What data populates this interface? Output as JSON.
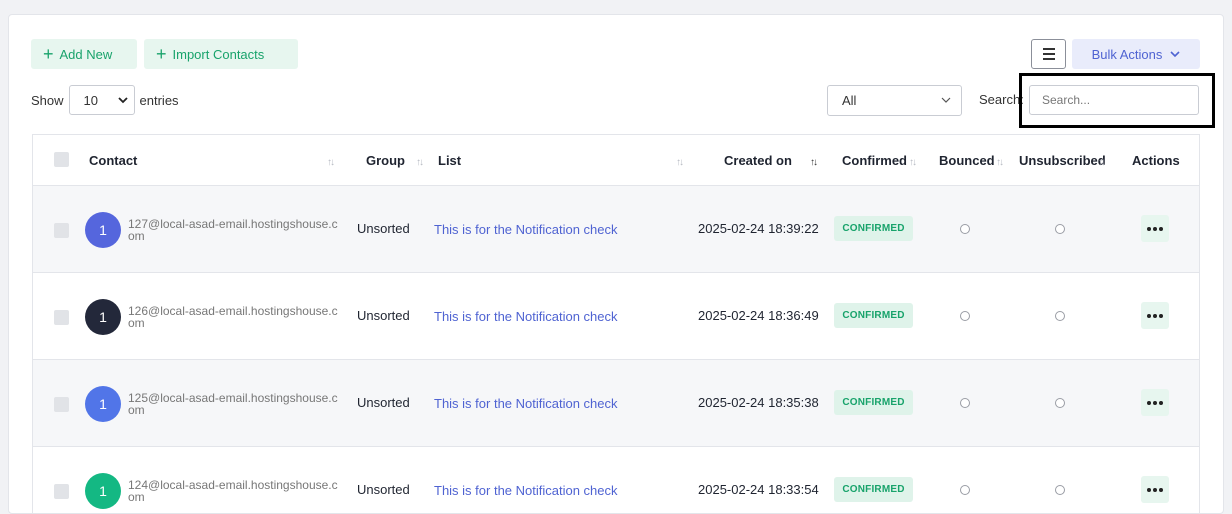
{
  "toolbar": {
    "add_new_label": "Add New",
    "import_label": "Import Contacts",
    "bulk_actions_label": "Bulk Actions"
  },
  "length": {
    "show_label": "Show",
    "value": "10",
    "entries_label": "entries"
  },
  "filter": {
    "selected": "All"
  },
  "search": {
    "label": "Search:",
    "placeholder": "Search..."
  },
  "table": {
    "columns": [
      "Contact",
      "Group",
      "List",
      "Created on",
      "Confirmed",
      "Bounced",
      "Unsubscribed",
      "Actions"
    ],
    "rows": [
      {
        "avatar_letter": "1",
        "avatar_color": "#5566dd",
        "email": "127@local-asad-email.hostingshouse.com",
        "group": "Unsorted",
        "list": "This is for the Notification check",
        "created": "2025-02-24 18:39:22",
        "status": "CONFIRMED"
      },
      {
        "avatar_letter": "1",
        "avatar_color": "#23283a",
        "email": "126@local-asad-email.hostingshouse.com",
        "group": "Unsorted",
        "list": "This is for the Notification check",
        "created": "2025-02-24 18:36:49",
        "status": "CONFIRMED"
      },
      {
        "avatar_letter": "1",
        "avatar_color": "#5175e8",
        "email": "125@local-asad-email.hostingshouse.com",
        "group": "Unsorted",
        "list": "This is for the Notification check",
        "created": "2025-02-24 18:35:38",
        "status": "CONFIRMED"
      },
      {
        "avatar_letter": "1",
        "avatar_color": "#14b883",
        "email": "124@local-asad-email.hostingshouse.com",
        "group": "Unsorted",
        "list": "This is for the Notification check",
        "created": "2025-02-24 18:33:54",
        "status": "CONFIRMED"
      }
    ]
  },
  "colors": {
    "accent_green": "#18a36b",
    "accent_blue": "#4f63d2"
  }
}
